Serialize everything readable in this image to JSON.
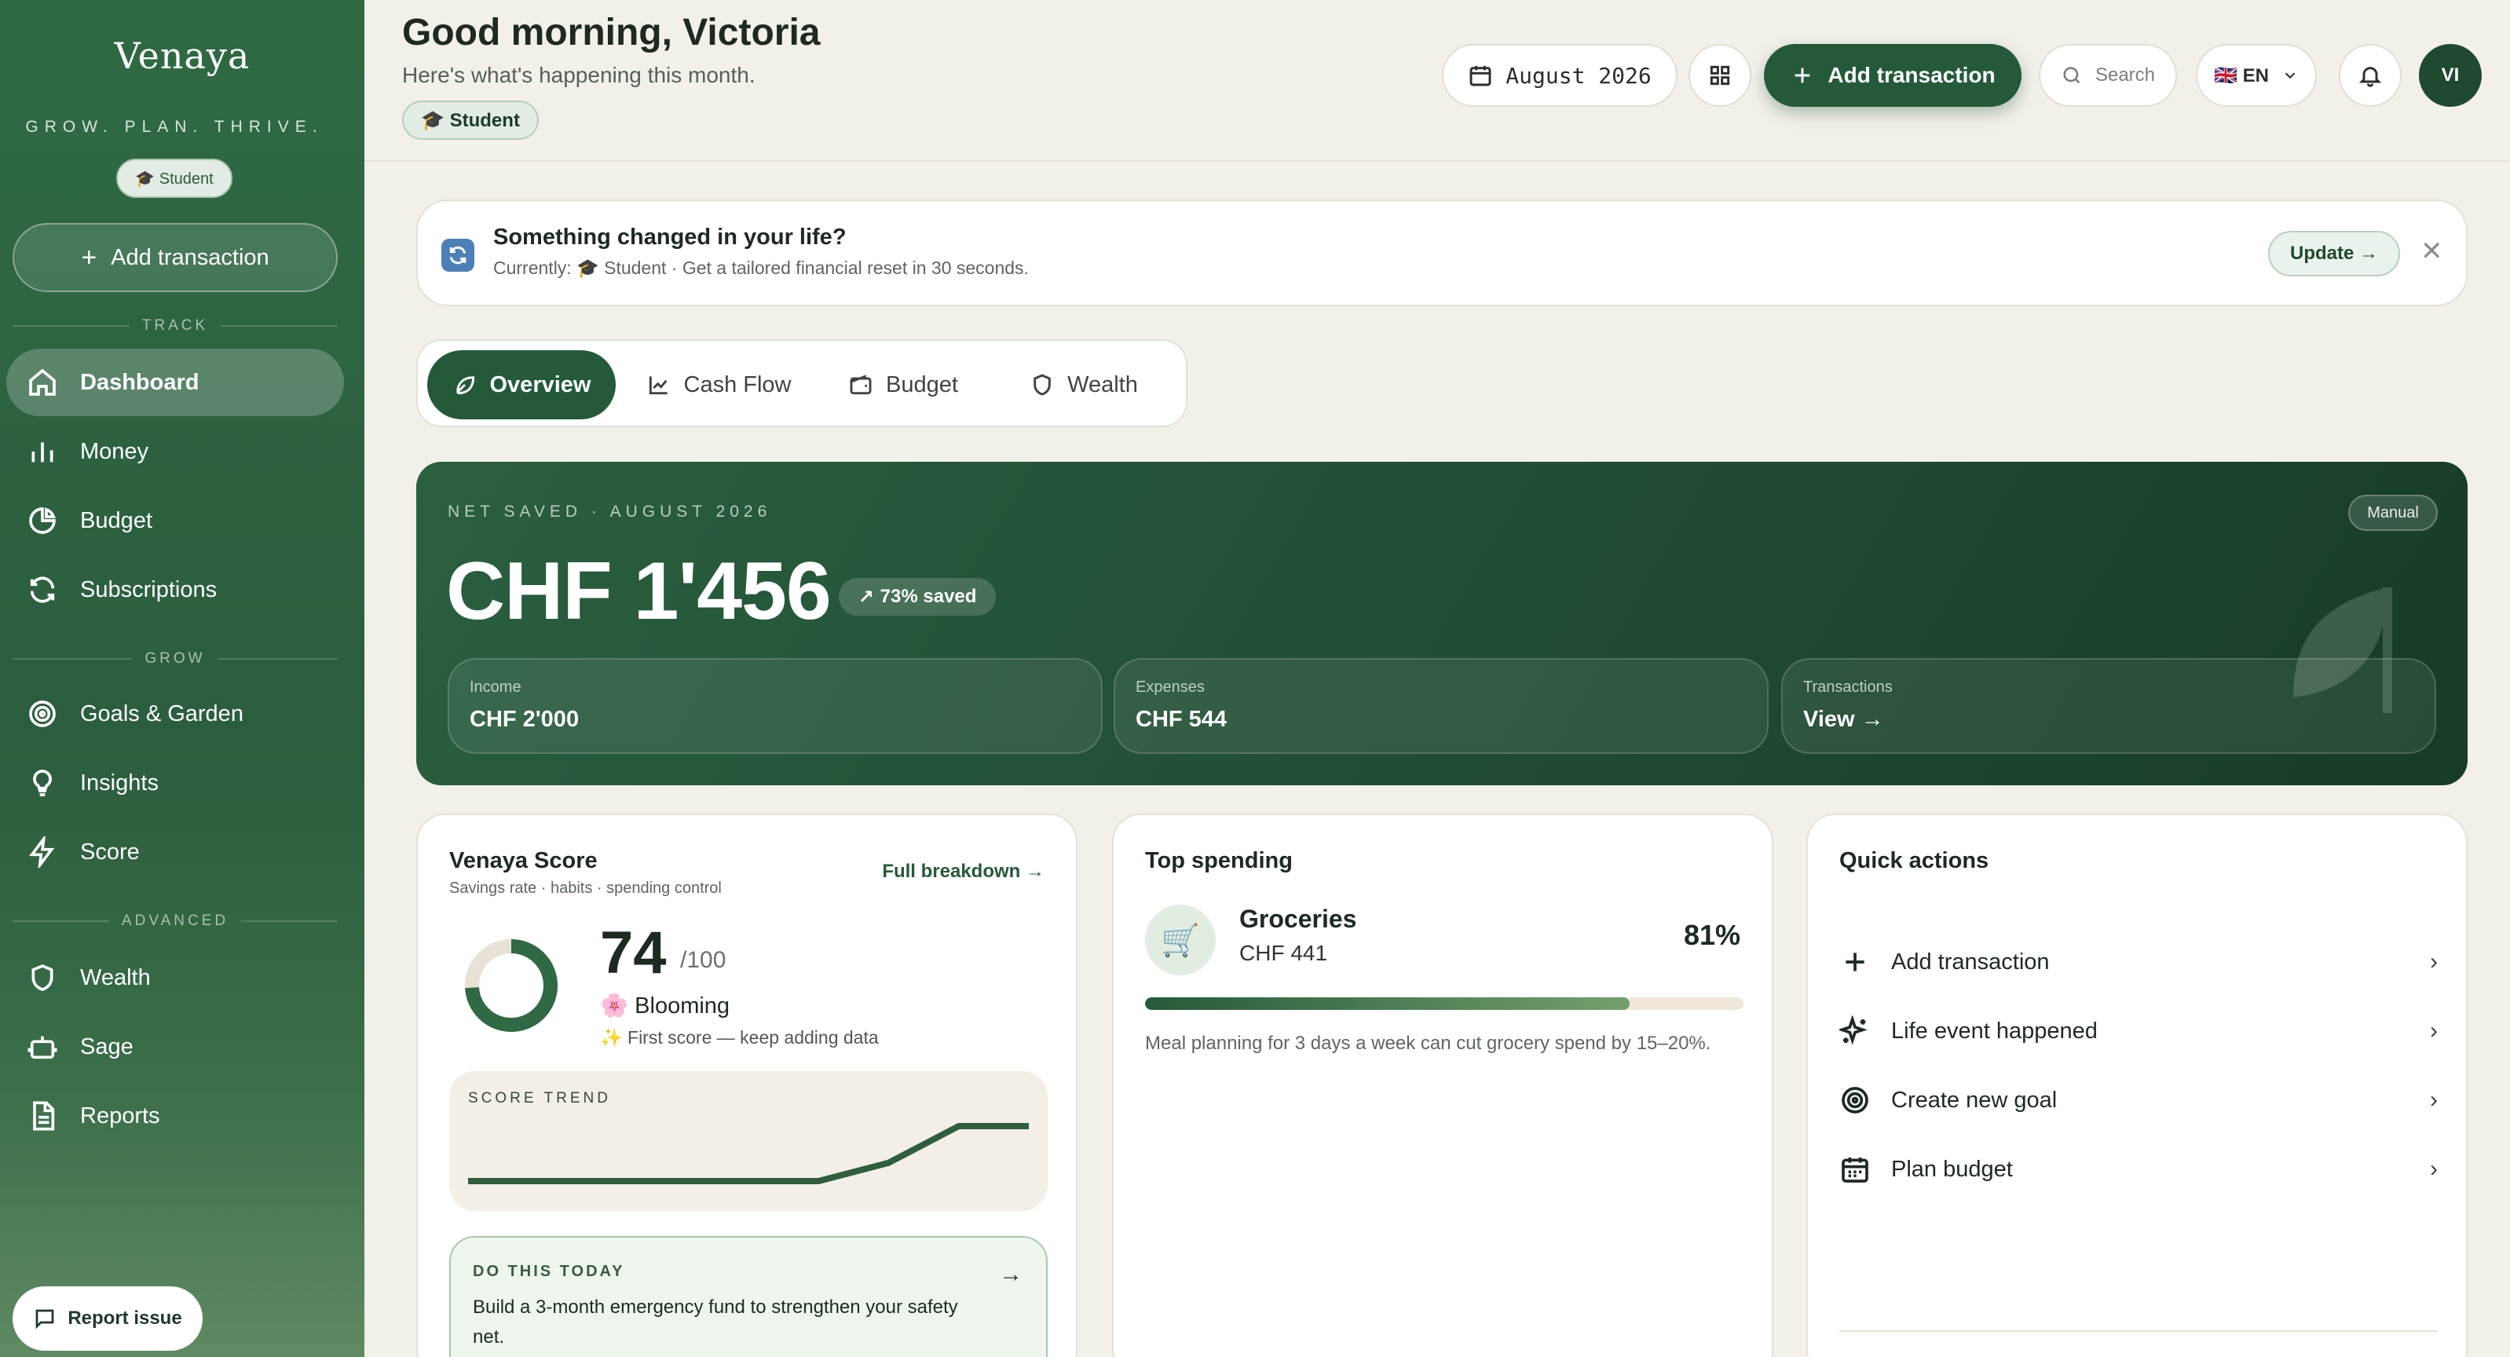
{
  "sidebar": {
    "logo": "Venaya",
    "tagline": "GROW. PLAN. THRIVE.",
    "badge": "🎓 Student",
    "add_label": "Add transaction",
    "sections": {
      "track": "TRACK",
      "grow": "GROW",
      "advanced": "ADVANCED"
    },
    "items": [
      {
        "label": "Dashboard",
        "icon": "home-icon",
        "active": true
      },
      {
        "label": "Money",
        "icon": "bar-chart-icon"
      },
      {
        "label": "Budget",
        "icon": "pie-chart-icon"
      },
      {
        "label": "Subscriptions",
        "icon": "refresh-icon"
      },
      {
        "label": "Goals & Garden",
        "icon": "target-icon"
      },
      {
        "label": "Insights",
        "icon": "lightbulb-icon"
      },
      {
        "label": "Score",
        "icon": "lightning-icon"
      },
      {
        "label": "Wealth",
        "icon": "shield-icon"
      },
      {
        "label": "Sage",
        "icon": "robot-icon"
      },
      {
        "label": "Reports",
        "icon": "document-icon"
      }
    ],
    "report_issue": "Report issue"
  },
  "header": {
    "greeting": "Good morning, Victoria",
    "subtitle": "Here's what's happening this month.",
    "badge": "🎓 Student",
    "date": "August 2026",
    "add_label": "Add transaction",
    "search_placeholder": "Search",
    "language": "🇬🇧 EN",
    "avatar_initials": "VI"
  },
  "banner": {
    "title": "Something changed in your life?",
    "subtitle": "Currently: 🎓 Student · Get a tailored financial reset in 30 seconds.",
    "update_label": "Update →",
    "close": "✕"
  },
  "tabs": [
    {
      "label": "Overview",
      "active": true
    },
    {
      "label": "Cash Flow"
    },
    {
      "label": "Budget"
    },
    {
      "label": "Wealth"
    }
  ],
  "hero": {
    "label": "NET SAVED · AUGUST 2026",
    "amount": "CHF 1'456",
    "saved_badge": "73% saved",
    "manual": "Manual",
    "stats": [
      {
        "label": "Income",
        "value": "CHF 2'000"
      },
      {
        "label": "Expenses",
        "value": "CHF 544"
      },
      {
        "label": "Transactions",
        "value": "View →"
      }
    ]
  },
  "score_card": {
    "title": "Venaya Score",
    "subtitle": "Savings rate · habits · spending control",
    "link": "Full breakdown →",
    "score": "74",
    "score_max": "/100",
    "score_value": 74,
    "status": "🌸 Blooming",
    "note": "✨ First score — keep adding data",
    "trend_label": "SCORE TREND",
    "trend_values": [
      0,
      0,
      0,
      0,
      0,
      0,
      10,
      30,
      30
    ],
    "today_label": "DO THIS TODAY",
    "today_text": "Build a 3-month emergency fund to strengthen your safety net.",
    "today_arrow": "→"
  },
  "spending_card": {
    "title": "Top spending",
    "category": "Groceries",
    "amount": "CHF 441",
    "percent": "81%",
    "percent_value": 81,
    "note": "Meal planning for 3 days a week can cut grocery spend by 15–20%.",
    "icon": "cart-icon"
  },
  "quick_actions": {
    "title": "Quick actions",
    "items": [
      {
        "label": "Add transaction",
        "icon": "plus-icon"
      },
      {
        "label": "Life event happened",
        "icon": "sparkle-icon"
      },
      {
        "label": "Create new goal",
        "icon": "target-icon"
      },
      {
        "label": "Plan budget",
        "icon": "calendar-icon"
      }
    ]
  },
  "colors": {
    "brand": "#245a3a",
    "sidebar": "#2b5d3e",
    "background": "#f3f0ea"
  }
}
